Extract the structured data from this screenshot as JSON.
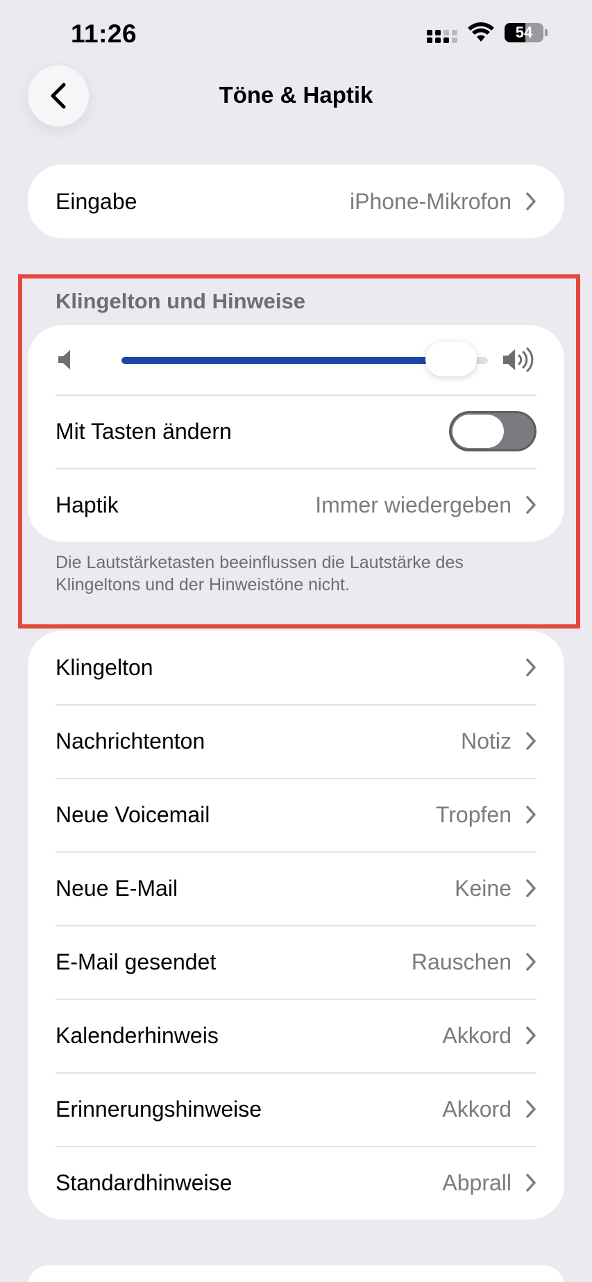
{
  "status_bar": {
    "time": "11:26",
    "battery_level": "54",
    "battery_percent": 54
  },
  "nav": {
    "title": "Töne & Haptik",
    "back_icon": "chevron-left-icon"
  },
  "input_card": {
    "label": "Eingabe",
    "value": "iPhone-Mikrofon"
  },
  "ringer_section": {
    "header": "Klingelton und Hinweise",
    "volume_fraction": 0.9,
    "change_with_buttons_label": "Mit Tasten ändern",
    "change_with_buttons_on": false,
    "haptics_label": "Haptik",
    "haptics_value": "Immer wiedergeben",
    "footer": "Die Lautstärketasten beeinflussen die Lautstärke des Klingeltons und der Hinweistöne nicht."
  },
  "sounds_list": [
    {
      "label": "Klingelton",
      "value": ""
    },
    {
      "label": "Nachrichtenton",
      "value": "Notiz"
    },
    {
      "label": "Neue Voicemail",
      "value": "Tropfen"
    },
    {
      "label": "Neue E-Mail",
      "value": "Keine"
    },
    {
      "label": "E-Mail gesendet",
      "value": "Rauschen"
    },
    {
      "label": "Kalenderhinweis",
      "value": "Akkord"
    },
    {
      "label": "Erinnerungshinweise",
      "value": "Akkord"
    },
    {
      "label": "Standardhinweise",
      "value": "Abprall"
    }
  ],
  "colors": {
    "accent": "#1C47A6",
    "highlight": "#E5473C",
    "background": "#EBEAF0"
  }
}
